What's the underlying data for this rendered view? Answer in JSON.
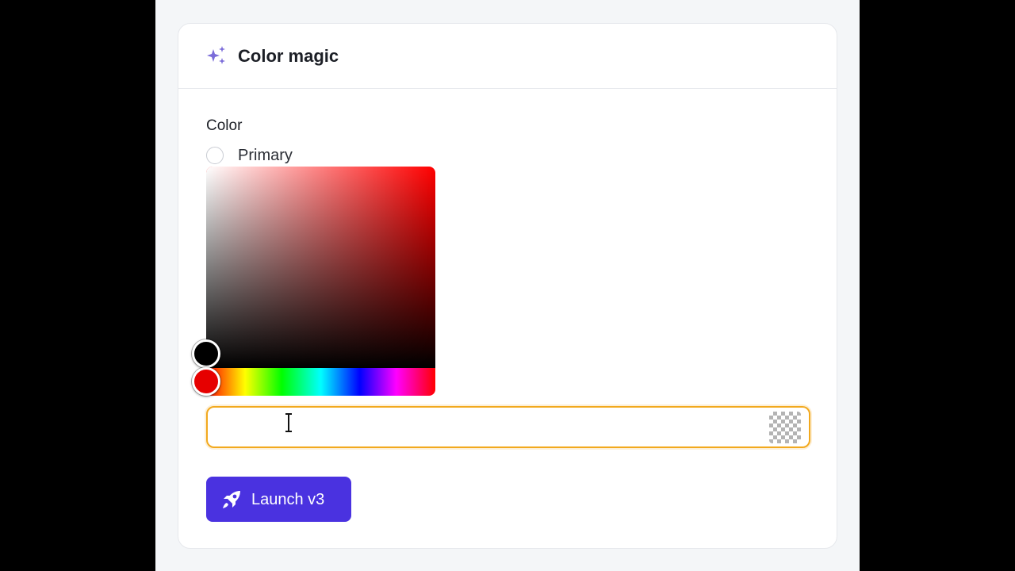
{
  "card": {
    "title": "Color magic",
    "title_icon": "sparkles-icon"
  },
  "form": {
    "color_label": "Color",
    "options": [
      {
        "label": "Primary",
        "selected": false
      }
    ],
    "picker": {
      "hue_color": "#ff0000",
      "selected_color": "#000000"
    },
    "color_input": {
      "value": "",
      "placeholder": ""
    }
  },
  "actions": {
    "launch_label": "Launch v3",
    "launch_icon": "rocket-icon"
  },
  "colors": {
    "accent": "#4a32e0",
    "input_focus": "#f2a91e",
    "sparkle": "#7b6cd9"
  }
}
